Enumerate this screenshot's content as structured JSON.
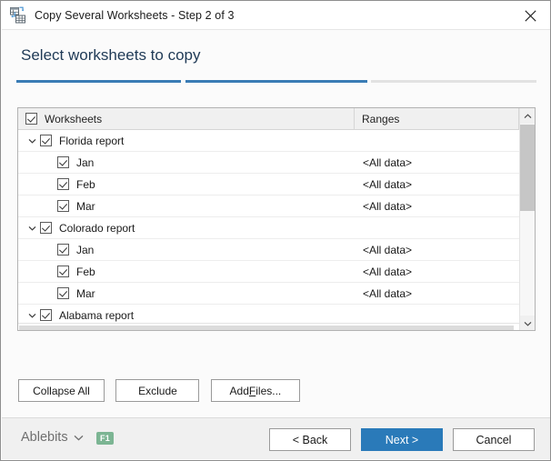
{
  "window": {
    "title": "Copy Several Worksheets - Step 2 of 3",
    "icon": "copy-worksheets-icon",
    "close_label": "×"
  },
  "header": {
    "page_title": "Select worksheets to copy",
    "steps": {
      "current": 2,
      "total": 3,
      "segments": [
        "done",
        "done",
        "todo"
      ],
      "done_color": "#3a7cb5",
      "todo_color": "#e2e2e2"
    }
  },
  "list": {
    "columns": [
      {
        "key": "worksheets",
        "label": "Worksheets",
        "has_checkbox": true,
        "checked": true
      },
      {
        "key": "ranges",
        "label": "Ranges",
        "has_checkbox": false
      }
    ],
    "rows": [
      {
        "type": "group",
        "label": "Florida report",
        "checked": true,
        "expanded": true,
        "range": ""
      },
      {
        "type": "child",
        "label": "Jan",
        "checked": true,
        "range": "<All data>"
      },
      {
        "type": "child",
        "label": "Feb",
        "checked": true,
        "range": "<All data>"
      },
      {
        "type": "child",
        "label": "Mar",
        "checked": true,
        "range": "<All data>"
      },
      {
        "type": "group",
        "label": "Colorado report",
        "checked": true,
        "expanded": true,
        "range": ""
      },
      {
        "type": "child",
        "label": "Jan",
        "checked": true,
        "range": "<All data>"
      },
      {
        "type": "child",
        "label": "Feb",
        "checked": true,
        "range": "<All data>"
      },
      {
        "type": "child",
        "label": "Mar",
        "checked": true,
        "range": "<All data>"
      },
      {
        "type": "group",
        "label": "Alabama report",
        "checked": true,
        "expanded": true,
        "range": ""
      }
    ],
    "scroll": {
      "vertical_thumb_percent": 45,
      "horizontal_thumb_percent": 99
    }
  },
  "actions": {
    "collapse_all": "Collapse All",
    "exclude": "Exclude",
    "add_files_pre": "Add ",
    "add_files_accel": "F",
    "add_files_post": "iles..."
  },
  "footer": {
    "brand": "Ablebits",
    "help_key": "F1",
    "help_key_color": "#7cb593",
    "back": "< Back",
    "next": "Next >",
    "cancel": "Cancel",
    "primary_color": "#2a7ab9"
  }
}
